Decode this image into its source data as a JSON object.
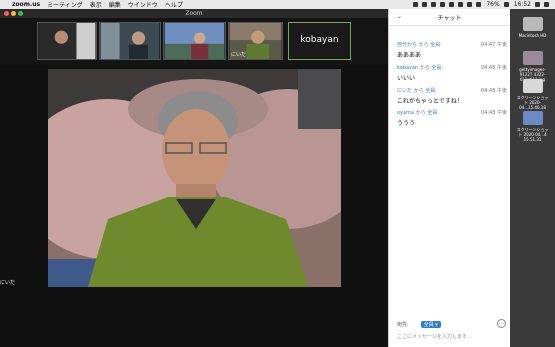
{
  "menubar": {
    "apple": "",
    "app": "zoom.us",
    "items": [
      "ミーティング",
      "表示",
      "編集",
      "ウインドウ",
      "ヘルプ"
    ],
    "battery": "76%",
    "clock": "16:52"
  },
  "window": {
    "title": "Zoom"
  },
  "thumbnails": [
    {
      "name": ""
    },
    {
      "name": ""
    },
    {
      "name": ""
    },
    {
      "name": "",
      "tag": "にいだ"
    },
    {
      "name": "kobayan"
    }
  ],
  "speaker_label": "にいだ",
  "chat": {
    "title": "チャット",
    "messages": [
      {
        "from": "自分から",
        "to": "全員:",
        "time": "04:47 午後",
        "text": "ああああ"
      },
      {
        "from": "kobayan",
        "to": "全員:",
        "time": "04:48 午後",
        "text": "いいい"
      },
      {
        "from": "にいだ",
        "to": "全員:",
        "time": "04:48 午後",
        "text": "これがちゃっとですね！"
      },
      {
        "from": "oyama",
        "to": "全員:",
        "time": "04:48 午後",
        "text": "ううう"
      }
    ],
    "connector": "から",
    "send_to_label": "宛先:",
    "send_to_value": "全員",
    "input_placeholder": "ここにメッセージを入力します…"
  },
  "desktop": [
    {
      "label": "Macintosh HD"
    },
    {
      "label": "gettyimages-91227 4322-612x612.jpg"
    },
    {
      "label": "スクリーンショット 2020-04...15.40.18"
    },
    {
      "label": "スクリーンショット 2020-04...4 15.51.31"
    }
  ]
}
